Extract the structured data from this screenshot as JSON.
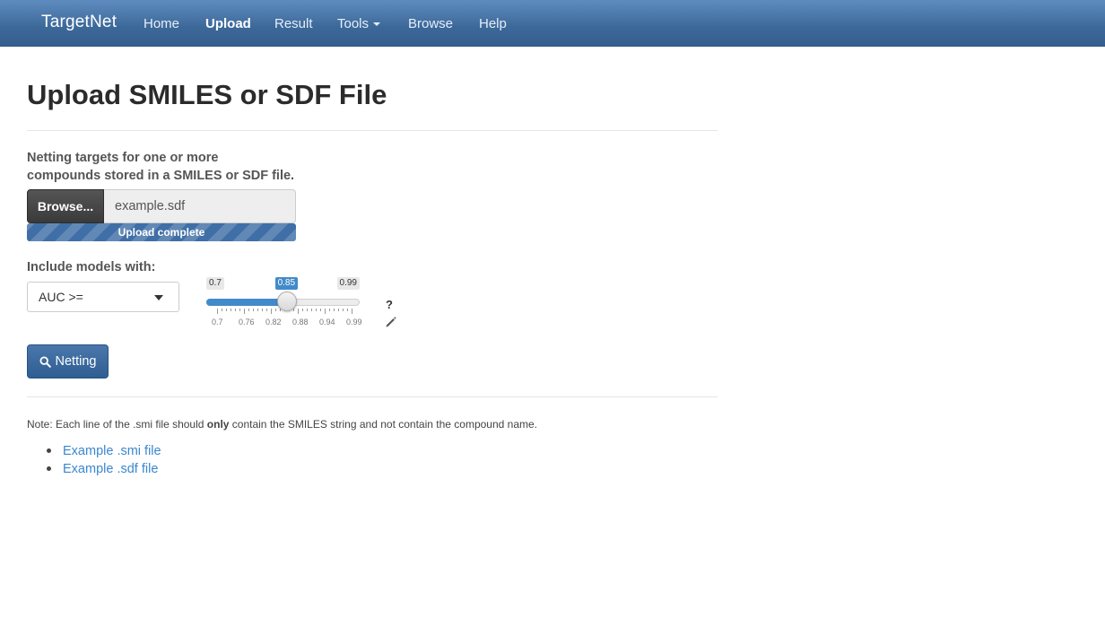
{
  "navbar": {
    "brand": "TargetNet",
    "items": [
      {
        "label": "Home"
      },
      {
        "label": "Upload",
        "active": true
      },
      {
        "label": "Result"
      },
      {
        "label": "Tools",
        "dropdown": true
      },
      {
        "label": "Browse"
      },
      {
        "label": "Help"
      }
    ]
  },
  "page": {
    "title": "Upload SMILES or SDF File",
    "description_line1": "Netting targets for one or more",
    "description_line2": "compounds stored in a SMILES or SDF file."
  },
  "upload": {
    "browse_label": "Browse...",
    "file_name": "example.sdf",
    "progress_text": "Upload complete",
    "progress_fraction": 1.0
  },
  "models": {
    "label": "Include models with:",
    "selected_option": "AUC >="
  },
  "slider": {
    "min": 0.7,
    "max": 0.99,
    "value": 0.85,
    "min_label": "0.7",
    "max_label": "0.99",
    "value_label": "0.85",
    "tick_labels": [
      "0.7",
      "0.76",
      "0.82",
      "0.88",
      "0.94",
      "0.99"
    ],
    "help_symbol": "?"
  },
  "actions": {
    "netting_label": "Netting",
    "netting_icon": "search-icon"
  },
  "note": {
    "prefix": "Note: Each line of the .smi file should ",
    "emphasis": "only",
    "suffix": " contain the SMILES string and not contain the compound name."
  },
  "links": [
    {
      "label": "Example .smi file"
    },
    {
      "label": "Example .sdf file"
    }
  ],
  "colors": {
    "navbar": "#3c6899",
    "primary": "#428bca",
    "link": "#3a87d0"
  }
}
